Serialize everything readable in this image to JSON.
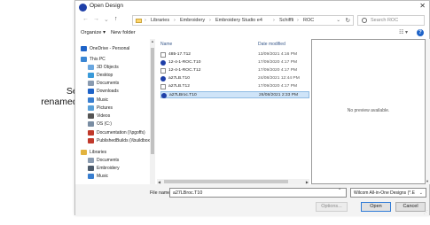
{
  "callout": {
    "line1": "Select",
    "line2": "renamed file"
  },
  "dialog": {
    "title": "Open Design",
    "close": "✕",
    "nav": {
      "back": "←",
      "forward": "→",
      "up": "↑",
      "recent": "⌄"
    },
    "breadcrumb": [
      "Libraries",
      "Embroidery",
      "Embroidery Studio e4",
      "SchiffIi",
      "ROC"
    ],
    "breadcrumb_sep": "›",
    "search_placeholder": "Search ROC",
    "toolbar": {
      "organize": "Organize ▾",
      "new_folder": "New folder",
      "view": "☷ ▾",
      "help": "?"
    },
    "nav_pane": [
      {
        "label": "OneDrive - Personal",
        "icon": "cloud-icon",
        "color": "#1e63c8"
      },
      {
        "label": "This PC",
        "icon": "pc-icon",
        "color": "#3a86d4"
      },
      {
        "label": "3D Objects",
        "icon": "cube-icon",
        "color": "#6aa7e0"
      },
      {
        "label": "Desktop",
        "icon": "desktop-icon",
        "color": "#3a9ad9"
      },
      {
        "label": "Documents",
        "icon": "documents-icon",
        "color": "#8a9bb0"
      },
      {
        "label": "Downloads",
        "icon": "downloads-icon",
        "color": "#1e63c8"
      },
      {
        "label": "Music",
        "icon": "music-icon",
        "color": "#3a7fd0"
      },
      {
        "label": "Pictures",
        "icon": "pictures-icon",
        "color": "#5aa0d8"
      },
      {
        "label": "Videos",
        "icon": "videos-icon",
        "color": "#555555"
      },
      {
        "label": "OS (C:)",
        "icon": "drive-icon",
        "color": "#7a8da3"
      },
      {
        "label": "Documentation (\\\\pgoffs)",
        "icon": "network-drive-icon",
        "color": "#c0392b"
      },
      {
        "label": "PublishedBuilds (\\\\buildbox)",
        "icon": "network-drive-icon",
        "color": "#c0392b"
      },
      {
        "label": "Libraries",
        "icon": "libraries-icon",
        "color": "#e2b33f"
      },
      {
        "label": "Documents",
        "icon": "documents-icon",
        "color": "#8a9bb0"
      },
      {
        "label": "Embroidery",
        "icon": "embroidery-library-icon",
        "color": "#4d5b6b"
      },
      {
        "label": "Music",
        "icon": "music-icon",
        "color": "#3a7fd0"
      }
    ],
    "columns": {
      "name": "Name",
      "date": "Date modified"
    },
    "files": [
      {
        "name": "485-17.T12",
        "date": "13/09/2021 4:16 PM",
        "icon": "document-icon"
      },
      {
        "name": "12-4-1-ROC.T10",
        "date": "17/09/2020 4:17 PM",
        "icon": "design-file-icon"
      },
      {
        "name": "12-4-1-ROC.T12",
        "date": "17/09/2020 4:17 PM",
        "icon": "document-icon"
      },
      {
        "name": "a27LB.T10",
        "date": "24/08/2021 12:44 PM",
        "icon": "design-file-icon"
      },
      {
        "name": "a27LB.T12",
        "date": "17/09/2020 4:17 PM",
        "icon": "document-icon"
      },
      {
        "name": "a27LBroc.T10",
        "date": "26/08/2021 2:33 PM",
        "icon": "design-file-icon"
      }
    ],
    "selected_index": 5,
    "preview_text": "No preview available.",
    "file_name_label": "File name:",
    "file_name_value": "a27LBroc.T10",
    "filter": "Wilcom All-in-One Designs (*.E",
    "buttons": {
      "options": "Options...",
      "open": "Open",
      "cancel": "Cancel"
    }
  }
}
